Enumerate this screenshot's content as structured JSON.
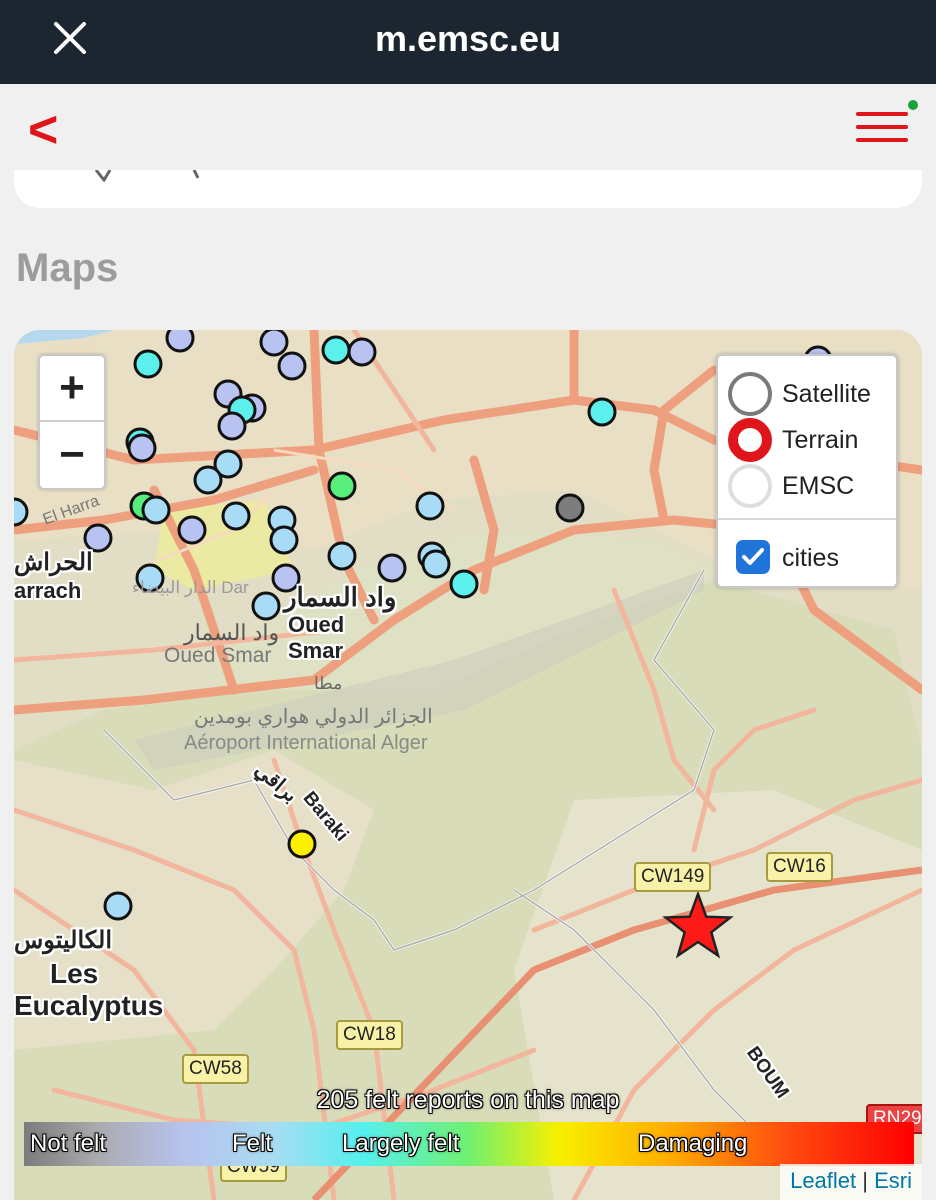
{
  "browser": {
    "url": "m.emsc.eu",
    "close_icon": "close-icon"
  },
  "nav": {
    "back_label": "<",
    "menu_icon": "hamburger-menu-icon",
    "notification_color": "#1aa13a",
    "accent": "#e0151b"
  },
  "section": {
    "title": "Maps"
  },
  "map": {
    "zoom_in": "+",
    "zoom_out": "−",
    "layers": {
      "options": [
        {
          "label": "Satellite",
          "selected": false
        },
        {
          "label": "Terrain",
          "selected": true
        },
        {
          "label": "EMSC",
          "selected": false
        }
      ],
      "overlay": {
        "label": "cities",
        "checked": true
      }
    },
    "labels": {
      "oued_smar_ar": "واد السمار",
      "oued_smar": "Oued Smar",
      "oued_smar_ar_faint": "واد السمار",
      "oued_smar_faint": "Oued Smar",
      "dar": "الدار البيضاء Dar",
      "airport_ar": "الجزائر الدولي هواري بومدين",
      "airport": "Aéroport International Alger",
      "baraki_ar": "براقي",
      "baraki": "Baraki",
      "eucalyptus_ar": "الكاليتوس",
      "les": "Les",
      "eucalyptus": "Eucalyptus",
      "harrach_ar": "الحراش",
      "harrach": "arrach",
      "el_harrach": "El Harra",
      "mata": "مطا",
      "boumerdes": "BOUM",
      "road_cw149": "CW149",
      "road_cw16": "CW16",
      "road_cw18": "CW18",
      "road_cw58": "CW58",
      "road_cw59": "CW59",
      "road_rn29": "RN29"
    },
    "felt_count_text": "205 felt reports on this map",
    "scale_labels": [
      "Not felt",
      "Felt",
      "Largely felt",
      "Damaging"
    ],
    "attribution": {
      "leaflet": "Leaflet",
      "separator": "|",
      "esri": "Esri"
    },
    "epicenter_color": "#ff1a1a",
    "report_colors": {
      "not_felt": "#7d7d7d",
      "felt_weak": "#b9c3f2",
      "felt": "#a8dcf6",
      "largely_felt": "#5cf0ec",
      "strong": "#58ee7a",
      "very_strong": "#fff000"
    }
  }
}
